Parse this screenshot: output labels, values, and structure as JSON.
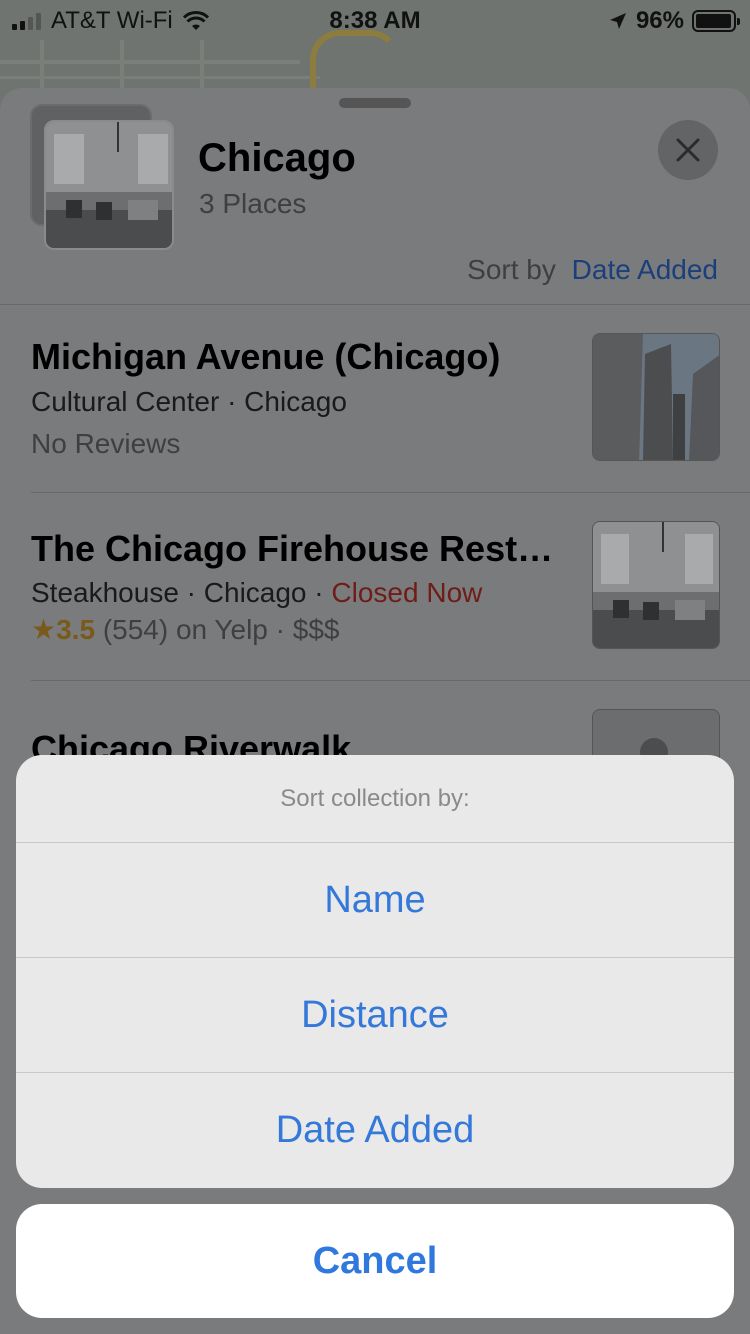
{
  "status_bar": {
    "carrier": "AT&T Wi-Fi",
    "time": "8:38 AM",
    "battery": "96%",
    "battery_level": 0.96,
    "signal_bars_filled": 2,
    "icons": [
      "signal-icon",
      "wifi-icon",
      "location-arrow-icon",
      "battery-icon"
    ]
  },
  "collection": {
    "title": "Chicago",
    "subtitle": "3 Places",
    "sort_label": "Sort by",
    "sort_value": "Date Added"
  },
  "places": [
    {
      "name": "Michigan Avenue (Chicago)",
      "line1": "Cultural Center · Chicago",
      "line2": "No Reviews"
    },
    {
      "name": "The Chicago Firehouse Rest…",
      "category": "Steakhouse · Chicago",
      "separator": " · ",
      "status": "Closed Now",
      "rating_star": "★",
      "rating": "3.5",
      "rating_rest": "(554) on Yelp · $$$"
    },
    {
      "name": "Chicago Riverwalk"
    }
  ],
  "action_sheet": {
    "header": "Sort collection by:",
    "options": [
      "Name",
      "Distance",
      "Date Added"
    ],
    "cancel": "Cancel"
  },
  "colors": {
    "accent": "#3478d9",
    "closed": "#c0392b",
    "rating": "#e0962c"
  }
}
